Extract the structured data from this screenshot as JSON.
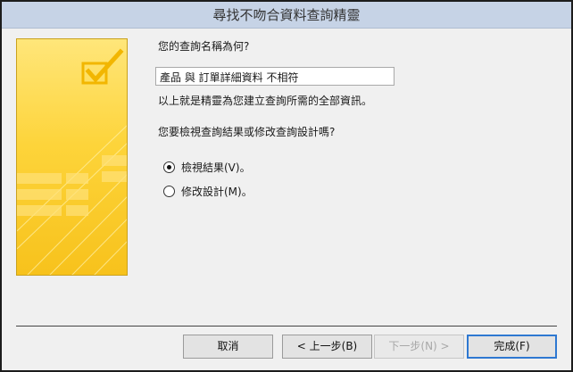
{
  "window": {
    "title": "尋找不吻合資料查詢精靈"
  },
  "art": {
    "icon": "checkbox-check-illustration"
  },
  "form": {
    "name_question": "您的查詢名稱為何?",
    "query_name_value": "產品 與 訂單詳細資料 不相符",
    "info_text": "以上就是精靈為您建立查詢所需的全部資訊。",
    "next_question": "您要檢視查詢結果或修改查詢設計嗎?",
    "options": [
      {
        "label": "檢視結果(V)。",
        "checked": true
      },
      {
        "label": "修改設計(M)。",
        "checked": false
      }
    ]
  },
  "buttons": {
    "cancel": "取消",
    "back": "< 上一步(B)",
    "next": "下一步(N) >",
    "finish": "完成(F)"
  }
}
